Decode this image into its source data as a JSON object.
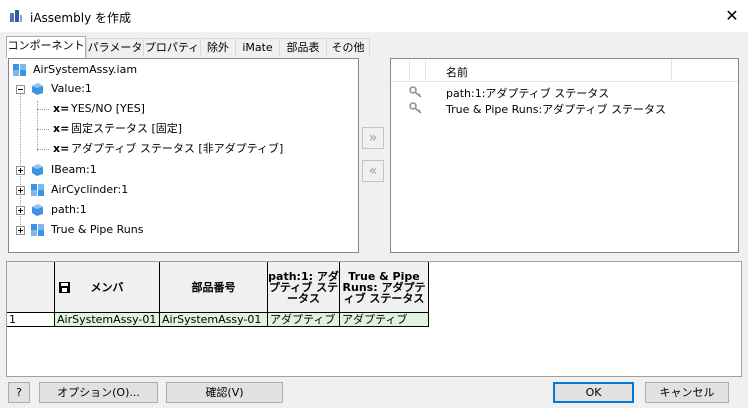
{
  "window": {
    "title": "iAssembly を作成"
  },
  "tabs": [
    {
      "label": "コンポーネント"
    },
    {
      "label": "パラメータ"
    },
    {
      "label": "プロパティ"
    },
    {
      "label": "除外"
    },
    {
      "label": "iMate"
    },
    {
      "label": "部品表"
    },
    {
      "label": "その他"
    }
  ],
  "tree": {
    "root": "AirSystemAssy.iam",
    "value_node": "Value:1",
    "value_children": [
      {
        "prefix": "x=",
        "label": "YES/NO [YES]"
      },
      {
        "prefix": "x=",
        "label": "固定ステータス [固定]"
      },
      {
        "prefix": "x=",
        "label": "アダプティブ ステータス [非アダプティブ]"
      }
    ],
    "other_nodes": [
      "IBeam:1",
      "AirCyclinder:1",
      "path:1",
      "True & Pipe Runs"
    ]
  },
  "move_buttons": {
    "add": "»",
    "remove": "«"
  },
  "selected_list": {
    "header": "名前",
    "items": [
      "path:1:アダプティブ ステータス",
      "True & Pipe Runs:アダプティブ ステータス"
    ]
  },
  "grid": {
    "columns": [
      "メンバ",
      "部品番号",
      "path:1: アダプティブ ステータス",
      "True & Pipe Runs: アダプティブ ステータス"
    ],
    "rows": [
      {
        "index": "1",
        "cells": [
          "AirSystemAssy-01",
          "AirSystemAssy-01",
          "アダプティブ",
          "アダプティブ"
        ]
      }
    ]
  },
  "footer": {
    "help": "?",
    "options": "オプション(O)...",
    "verify": "確認(V)",
    "ok": "OK",
    "cancel": "キャンセル"
  },
  "colors": {
    "accent": "#0078d7",
    "cube_blue": "#3c94e0",
    "row_highlight": "#ddf5dd"
  }
}
